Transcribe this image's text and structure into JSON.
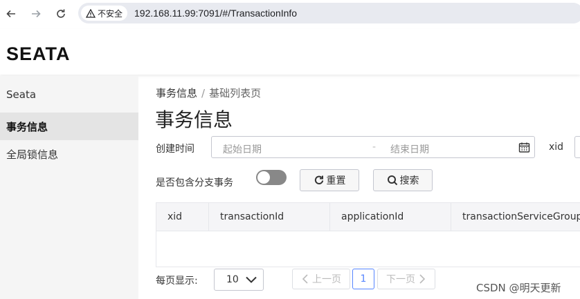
{
  "browser": {
    "security_label": "不安全",
    "url": "192.168.11.99:7091/#/TransactionInfo"
  },
  "header": {
    "logo": "SEATA"
  },
  "sidebar": {
    "title": "Seata",
    "items": [
      {
        "label": "事务信息",
        "active": true
      },
      {
        "label": "全局锁信息",
        "active": false
      }
    ]
  },
  "breadcrumb": {
    "parent": "事务信息",
    "separator": "/",
    "current": "基础列表页"
  },
  "page_title": "事务信息",
  "filters": {
    "create_time_label": "创建时间",
    "start_placeholder": "起始日期",
    "range_separator": "-",
    "end_placeholder": "结束日期",
    "xid_label": "xid",
    "branch_toggle_label": "是否包含分支事务",
    "branch_toggle_on": false,
    "reset_button": "重置",
    "search_button": "搜索"
  },
  "table": {
    "columns": [
      "xid",
      "transactionId",
      "applicationId",
      "transactionServiceGroup"
    ],
    "rows": []
  },
  "pagination": {
    "page_size_label": "每页显示:",
    "page_size_value": "10",
    "prev_label": "上一页",
    "current_page": "1",
    "next_label": "下一页"
  },
  "watermark": "CSDN @明天更新",
  "colors": {
    "accent": "#5584ff",
    "sidebar_bg": "#f5f5f5",
    "switch_off": "#888888"
  }
}
